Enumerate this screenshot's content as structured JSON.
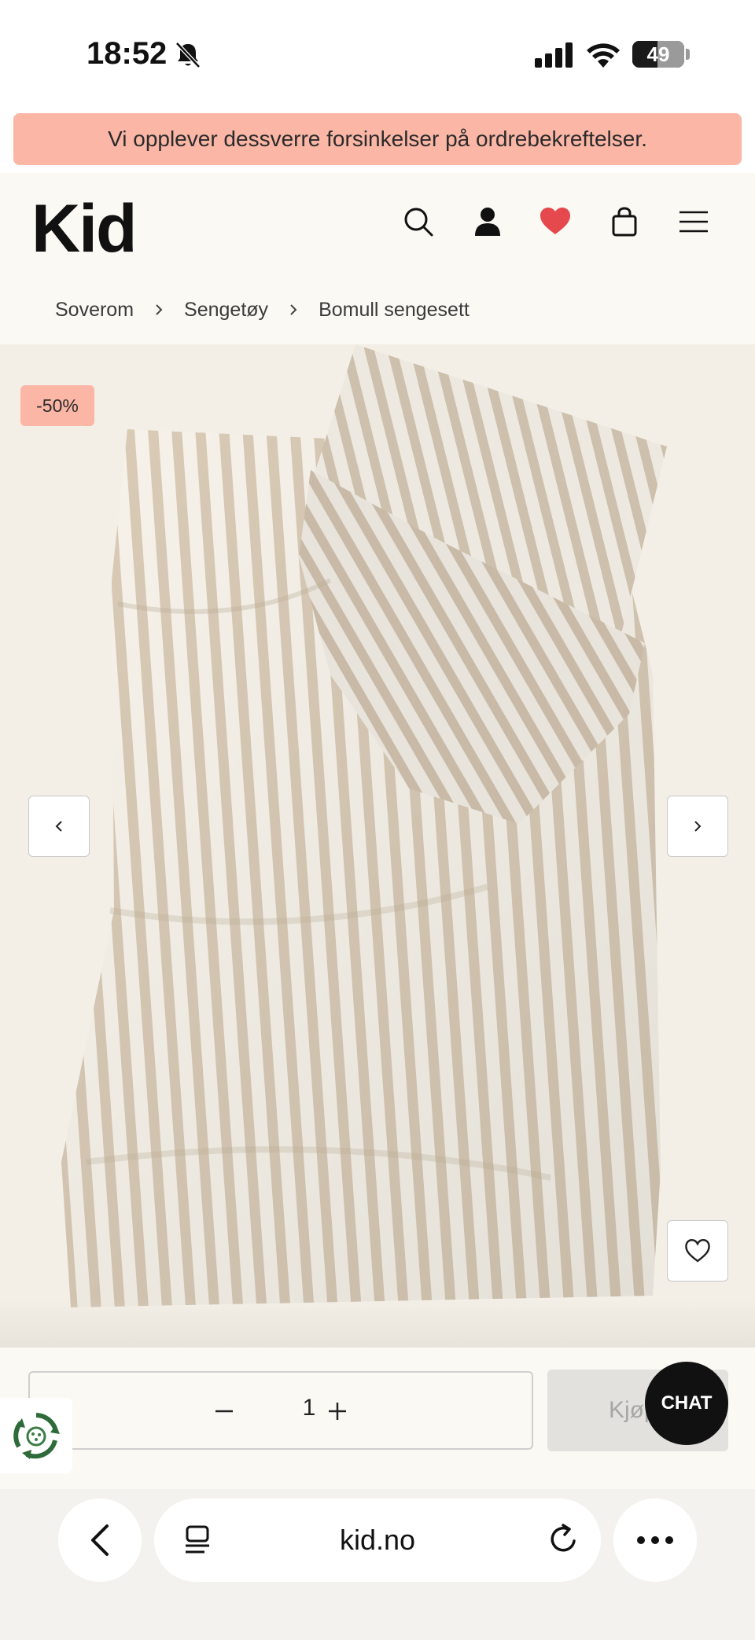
{
  "status_bar": {
    "time": "18:52",
    "battery_level": "49",
    "battery_fraction": 0.49,
    "icons": [
      "bell-muted-icon",
      "signal-icon",
      "wifi-icon",
      "battery-icon"
    ]
  },
  "announcement": {
    "text": "Vi opplever dessverre forsinkelser på ordrebekreftelser.",
    "background_color": "#fbb6a6"
  },
  "header": {
    "logo": "Kid",
    "icons": [
      "search-icon",
      "account-icon",
      "favorites-heart-icon",
      "shopping-bag-icon",
      "menu-icon"
    ],
    "heart_color": "#e5484d"
  },
  "breadcrumb": {
    "items": [
      "Soverom",
      "Sengetøy",
      "Bomull sengesett"
    ]
  },
  "product": {
    "discount_badge": "-50%",
    "image_description_icon": "striped-bedding-image",
    "stripe_color": "#d9cbb6"
  },
  "purchase": {
    "quantity": "1",
    "buy_label": "Kjøp",
    "chat_label": "CHAT"
  },
  "browser": {
    "url": "kid.no"
  }
}
